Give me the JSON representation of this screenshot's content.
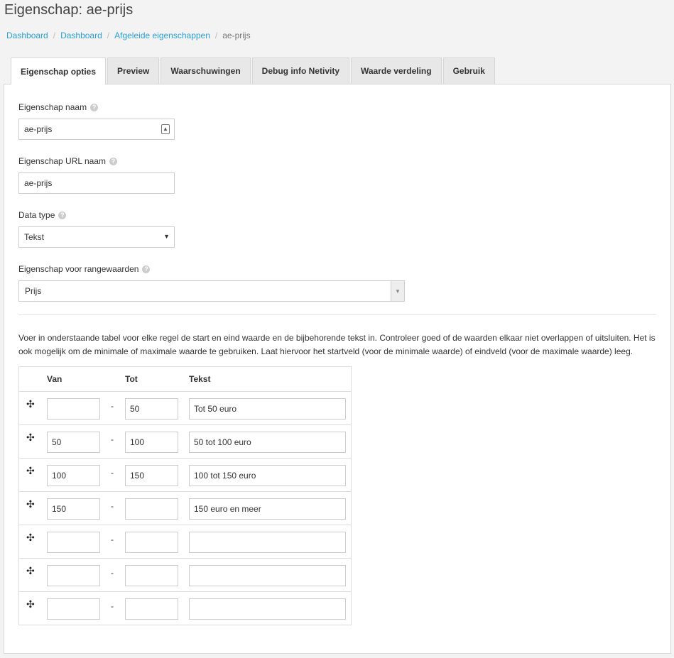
{
  "page": {
    "title": "Eigenschap: ae-prijs"
  },
  "breadcrumb": {
    "items": [
      "Dashboard",
      "Dashboard",
      "Afgeleide eigenschappen"
    ],
    "current": "ae-prijs",
    "separator": "/"
  },
  "tabs": [
    {
      "label": "Eigenschap opties",
      "active": true
    },
    {
      "label": "Preview"
    },
    {
      "label": "Waarschuwingen"
    },
    {
      "label": "Debug info Netivity"
    },
    {
      "label": "Waarde verdeling"
    },
    {
      "label": "Gebruik"
    }
  ],
  "form": {
    "name_label": "Eigenschap naam",
    "name_value": "ae-prijs",
    "url_label": "Eigenschap URL naam",
    "url_value": "ae-prijs",
    "datatype_label": "Data type",
    "datatype_value": "Tekst",
    "range_label": "Eigenschap voor rangewaarden",
    "range_value": "Prijs"
  },
  "info_text": "Voer in onderstaande tabel voor elke regel de start en eind waarde en de bijbehorende tekst in. Controleer goed of de waarden elkaar niet overlappen of uitsluiten. Het is ook mogelijk om de minimale of maximale waarde te gebruiken. Laat hiervoor het startveld (voor de minimale waarde) of eindveld (voor de maximale waarde) leeg.",
  "table": {
    "headers": {
      "van": "Van",
      "tot": "Tot",
      "tekst": "Tekst"
    },
    "dash": "-",
    "rows": [
      {
        "van": "",
        "tot": "50",
        "tekst": "Tot 50 euro"
      },
      {
        "van": "50",
        "tot": "100",
        "tekst": "50 tot 100 euro"
      },
      {
        "van": "100",
        "tot": "150",
        "tekst": "100 tot 150 euro"
      },
      {
        "van": "150",
        "tot": "",
        "tekst": "150 euro en meer"
      },
      {
        "van": "",
        "tot": "",
        "tekst": ""
      },
      {
        "van": "",
        "tot": "",
        "tekst": ""
      },
      {
        "van": "",
        "tot": "",
        "tekst": ""
      }
    ]
  },
  "icons": {
    "help": "help-icon",
    "move": "move-icon",
    "contact": "contact-card-icon"
  },
  "colors": {
    "link": "#2a9fd6",
    "panel_bg": "#ffffff",
    "page_bg": "#f3f3f3"
  }
}
